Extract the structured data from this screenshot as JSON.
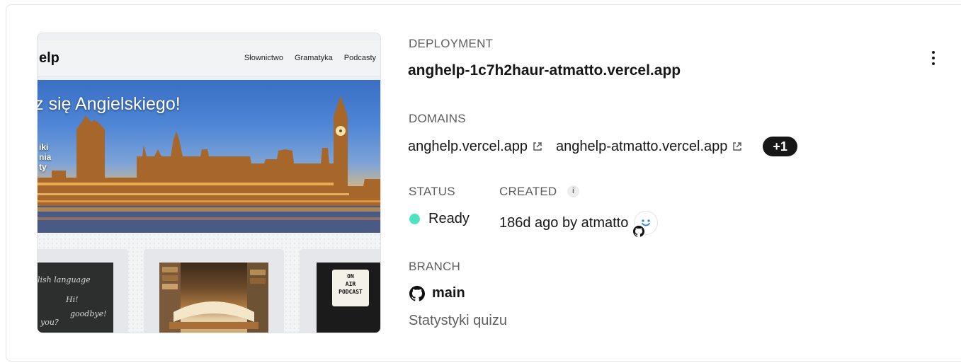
{
  "preview": {
    "logo": "elp",
    "nav_links": [
      "Słownictwo",
      "Gramatyka",
      "Podcasty"
    ],
    "hero_title": "z się Angielskiego!",
    "hero_side": [
      "iki",
      "nia",
      "ty"
    ],
    "thumb1_lines": [
      "lish language",
      "Hi!",
      "goodbye!",
      "you?"
    ],
    "thumb3_lines": [
      "ON",
      "AIR",
      "PODCAST"
    ]
  },
  "deployment": {
    "label": "DEPLOYMENT",
    "url": "anghelp-1c7h2haur-atmatto.vercel.app"
  },
  "domains": {
    "label": "DOMAINS",
    "items": [
      "anghelp.vercel.app",
      "anghelp-atmatto.vercel.app"
    ],
    "more": "+1"
  },
  "status": {
    "label": "STATUS",
    "value": "Ready",
    "color": "#50e3c2"
  },
  "created": {
    "label": "CREATED",
    "info_icon": "i",
    "value": "186d ago by atmatto"
  },
  "branch": {
    "label": "BRANCH",
    "name": "main",
    "commit_message": "Statystyki quizu"
  },
  "icons": {
    "external_link": "external-link-icon",
    "github": "github-icon",
    "menu": "more-vertical-icon"
  }
}
